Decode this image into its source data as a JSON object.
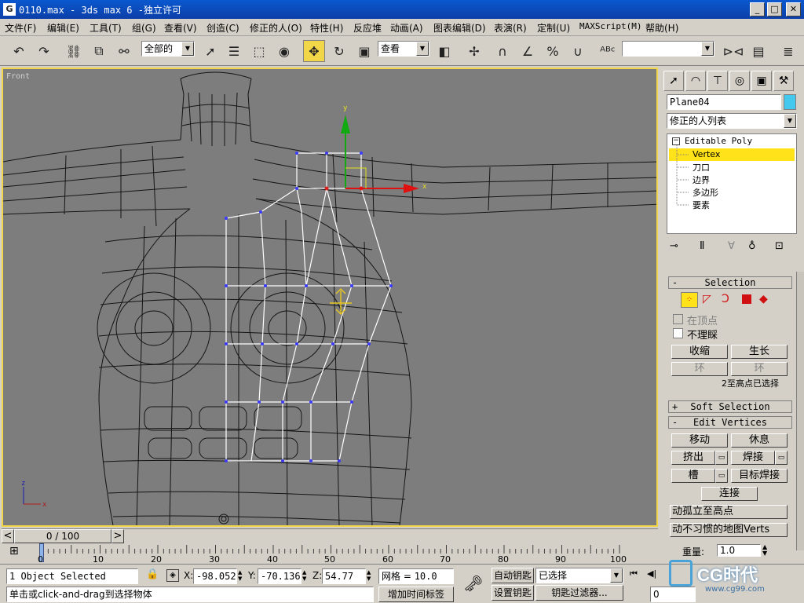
{
  "window": {
    "app_icon": "G",
    "title": "0110.max - 3ds max 6 -独立许可",
    "buttons": {
      "minimize": "_",
      "maximize": "□",
      "close": "✕"
    }
  },
  "menu": [
    "文件(F)",
    "编辑(E)",
    "工具(T)",
    "组(G)",
    "查看(V)",
    "创造(C)",
    "修正的人(O)",
    "特性(H)",
    "反应堆",
    "动画(A)",
    "图表编辑(D)",
    "表演(R)",
    "定制(U)",
    "MAXScript(M)",
    "帮助(H)"
  ],
  "toolbar": {
    "selection_filter": "全部的",
    "ref_coord": "查看",
    "named_selection": ""
  },
  "viewport": {
    "label": "Front",
    "gizmo": {
      "x": "x",
      "y": "y"
    },
    "axis": {
      "x": "x",
      "z": "z"
    }
  },
  "command_panel": {
    "tabs": [
      "create-icon",
      "modify-icon",
      "hierarchy-icon",
      "motion-icon",
      "display-icon",
      "utilities-icon"
    ],
    "object_name": "Plane04",
    "object_color": "#44c8ee",
    "modifier_list": "修正的人列表",
    "stack": {
      "root": "Editable Poly",
      "items": [
        "Vertex",
        "刀口",
        "边界",
        "多边形",
        "要素"
      ],
      "selected": "Vertex"
    },
    "selection": {
      "title": "Selection",
      "collapse": "-",
      "by_vertex": "在顶点",
      "ignore_backfacing": "不理睬",
      "shrink": "收缩",
      "grow": "生长",
      "ring": "环",
      "loop": "环",
      "status": "2至高点已选择"
    },
    "soft_selection": {
      "title": "Soft Selection",
      "expand": "+"
    },
    "edit_vertices": {
      "title": "Edit Vertices",
      "collapse": "-",
      "move": "移动",
      "rest": "休息",
      "extrude": "挤出",
      "weld": "焊接",
      "chamfer": "槽",
      "target_weld": "目标焊接",
      "connect": "连接",
      "remove_isolated": "动孤立至高点",
      "remove_unused_map": "动不习惯的地图Verts",
      "weight_label": "重量:",
      "weight_value": "1.0"
    }
  },
  "timeline": {
    "frame": "0 / 100",
    "prev": "<",
    "next": ">",
    "ticks": [
      "0",
      "10",
      "20",
      "30",
      "40",
      "50",
      "60",
      "70",
      "80",
      "90",
      "100"
    ]
  },
  "status": {
    "selected": "1 Object Selected",
    "prompt": "单击或click-and-drag到选择物体",
    "x_label": "X:",
    "x_value": "-98.052",
    "y_label": "Y:",
    "y_value": "-70.136",
    "z_label": "Z:",
    "z_value": "54.77",
    "grid_label": "网格 =",
    "grid_value": "10.0",
    "add_time_tag": "增加时间标签",
    "auto_key": "自动钥匙",
    "set_key": "设置钥匙",
    "selected_filter": "已选择",
    "key_filters": "钥匙过滤器...",
    "frame_value": "0",
    "watermark": "CG时代",
    "watermark_sub": "www.cg99.com"
  }
}
